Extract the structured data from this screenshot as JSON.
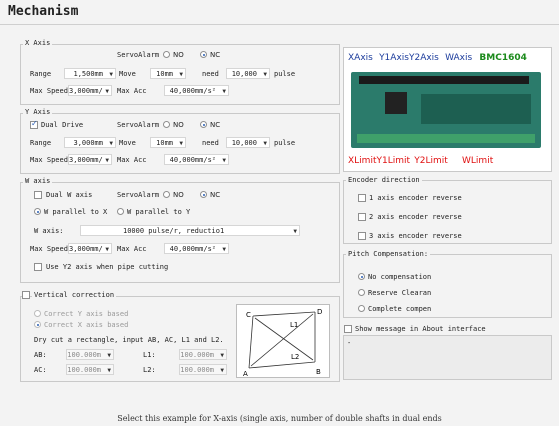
{
  "title": "Mechanism",
  "x_axis": {
    "group_label": "X Axis",
    "servo_alarm_label": "ServoAlarm",
    "no_label": "NO",
    "nc_label": "NC",
    "range_label": "Range",
    "range_value": "1,500mm",
    "move_label": "Move",
    "move_value": "10mm",
    "need_label": "need",
    "need_value": "10,000",
    "pulse_label": "pulse",
    "max_speed_label": "Max Speed",
    "max_speed_value": "3,000mm/",
    "max_acc_label": "Max Acc",
    "max_acc_value": "40,000mm/s²"
  },
  "y_axis": {
    "group_label": "Y Axis",
    "dual_drive_label": "Dual Drive",
    "servo_alarm_label": "ServoAlarm",
    "no_label": "NO",
    "nc_label": "NC",
    "range_label": "Range",
    "range_value": "3,000mm",
    "move_label": "Move",
    "move_value": "10mm",
    "need_label": "need",
    "need_value": "10,000",
    "pulse_label": "pulse",
    "max_speed_label": "Max Speed",
    "max_speed_value": "3,000mm/",
    "max_acc_label": "Max Acc",
    "max_acc_value": "40,000mm/s²"
  },
  "w_axis": {
    "group_label": "W axis",
    "dual_w_label": "Dual W axis",
    "servo_alarm_label": "ServoAlarm",
    "no_label": "NO",
    "nc_label": "NC",
    "parallel_x_label": "W parallel to X",
    "parallel_y_label": "W parallel to Y",
    "w_axis_label": "W axis:",
    "w_axis_value": "10000",
    "w_axis_unit": "pulse/r, reductio1",
    "max_speed_label": "Max Speed",
    "max_speed_value": "3,000mm/",
    "max_acc_label": "Max Acc",
    "max_acc_value": "40,000mm/s²",
    "use_y2_label": "Use Y2 axis when pipe cutting"
  },
  "vertical": {
    "group_label": "Vertical correction",
    "correct_y_label": "Correct Y axis based",
    "correct_x_label": "Correct X axis based",
    "instruction": "Dry cut a rectangle, input AB, AC, L1 and L2.",
    "ab_label": "AB:",
    "ab_value": "100.000m",
    "ac_label": "AC:",
    "ac_value": "100.000m",
    "l1_label": "L1:",
    "l1_value": "100.000m",
    "l2_label": "L2:",
    "l2_value": "100.000m",
    "diagram": {
      "a": "A",
      "b": "B",
      "c": "C",
      "d": "D",
      "l1": "L1",
      "l2": "L2"
    }
  },
  "board": {
    "top_labels": [
      "XAxis",
      "Y1Axis",
      "Y2Axis",
      "WAxis"
    ],
    "model": "BMC1604",
    "bottom_labels": [
      "XLimit",
      "Y1Limit",
      "Y2Limit",
      "WLimit"
    ]
  },
  "encoder": {
    "group_label": "Encoder direction",
    "items": [
      "1 axis encoder reverse",
      "2 axis encoder reverse",
      "3 axis encoder reverse"
    ]
  },
  "pitch": {
    "group_label": "Pitch Compensation:",
    "options": [
      "No compensation",
      "Reserve Clearan",
      "Complete compen"
    ]
  },
  "show_message_label": "Show message in About interface",
  "message_text": "-",
  "caption": "Select this example for X-axis (single axis, number of double shafts in dual ends"
}
